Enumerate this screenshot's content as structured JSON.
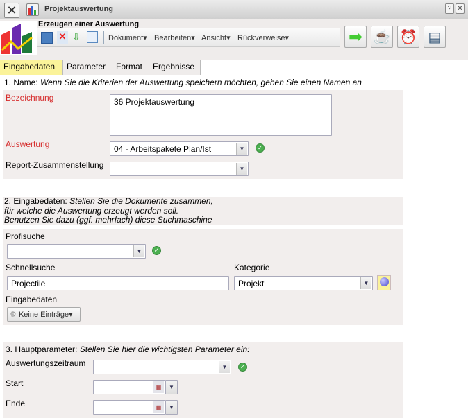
{
  "window": {
    "title": "Projektauswertung",
    "help": "?",
    "close": "✕"
  },
  "toolbar": {
    "heading": "Erzeugen einer Auswertung",
    "menus": [
      "Dokument",
      "Bearbeiten",
      "Ansicht",
      "Rückverweise"
    ]
  },
  "tabs": [
    "Eingabedaten",
    "Parameter",
    "Format",
    "Ergebnisse"
  ],
  "section1": {
    "number": "1. Name:",
    "hint": "Wenn Sie die Kriterien der Auswertung speichern möchten, geben Sie einen Namen an",
    "bezeichnung_label": "Bezeichnung",
    "bezeichnung_value": "36 Projektauswertung",
    "auswertung_label": "Auswertung",
    "auswertung_value": "04 - Arbeitspakete Plan/Ist",
    "report_label": "Report-Zusammenstellung",
    "report_value": ""
  },
  "section2": {
    "number": "2. Eingabedaten:",
    "hint1": "Stellen Sie die Dokumente zusammen,",
    "hint2": "für welche die Auswertung erzeugt werden soll.",
    "hint3": "Benutzen Sie dazu (ggf. mehrfach) diese Suchmaschine",
    "profisuche_label": "Profisuche",
    "profisuche_value": "",
    "schnellsuche_label": "Schnellsuche",
    "schnellsuche_value": "Projectile",
    "kategorie_label": "Kategorie",
    "kategorie_value": "Projekt",
    "eingabedaten_label": "Eingabedaten",
    "eingabedaten_button": "Keine Einträge"
  },
  "section3": {
    "number": "3. Hauptparameter:",
    "hint": "Stellen Sie hier die wichtigsten Parameter ein:",
    "zeitraum_label": "Auswertungszeitraum",
    "zeitraum_value": "",
    "start_label": "Start",
    "start_value": "",
    "ende_label": "Ende",
    "ende_value": ""
  },
  "colors": {
    "active_tab": "#fbf39a",
    "panel": "#f2eeed",
    "required_label": "#d62b2b"
  }
}
